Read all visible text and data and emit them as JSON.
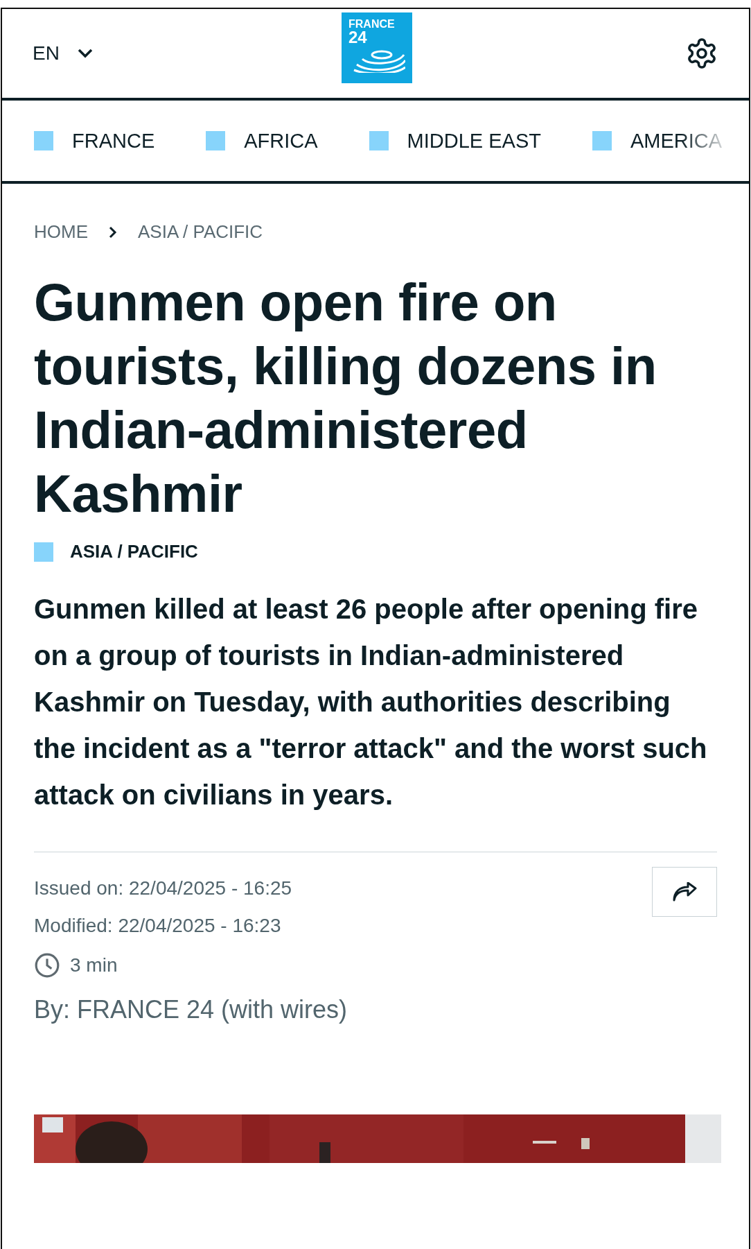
{
  "header": {
    "language": "EN",
    "logo": {
      "line_1": "FRANCE",
      "line_2": "24"
    }
  },
  "sections": [
    {
      "label": "FRANCE",
      "color": "#87d4fb"
    },
    {
      "label": "AFRICA",
      "color": "#87d4fb"
    },
    {
      "label": "MIDDLE EAST",
      "color": "#87d4fb"
    },
    {
      "label": "AMERICA",
      "color": "#87d4fb"
    }
  ],
  "breadcrumb": [
    "HOME",
    "ASIA / PACIFIC"
  ],
  "article": {
    "title": "Gunmen open fire on tourists, killing dozens in Indian-administered Kashmir",
    "tag": {
      "label": "ASIA / PACIFIC",
      "color": "#87d4fb"
    },
    "summary": "Gunmen killed at least 26 people after opening fire on a group of tourists in Indian-administered Kashmir on Tuesday, with authorities describing the incident as a \"terror attack\" and the worst such attack on civilians in years.",
    "issued": "Issued on: 22/04/2025 - 16:25",
    "modified": "Modified: 22/04/2025 - 16:23",
    "reading_time": "3 min",
    "byline": "By: FRANCE 24 (with wires)"
  }
}
